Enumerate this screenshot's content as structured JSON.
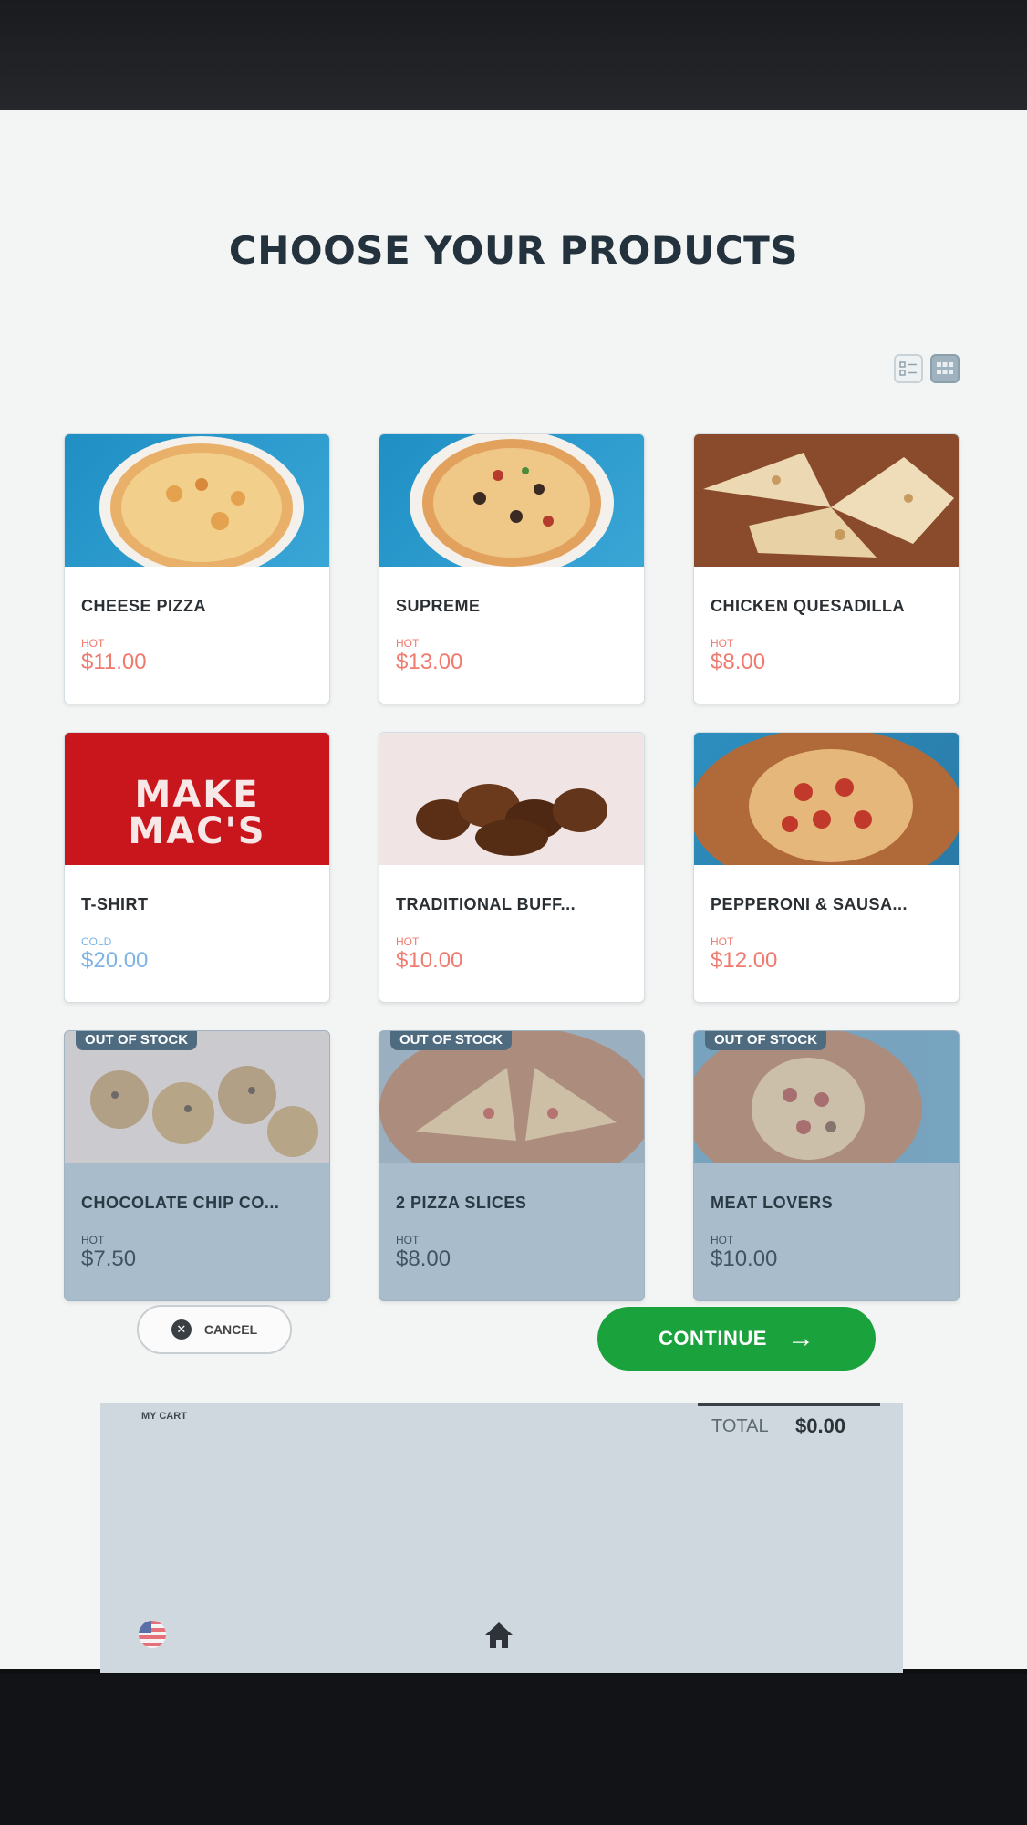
{
  "page": {
    "title": "CHOOSE YOUR PRODUCTS"
  },
  "view_toggle": {
    "options": [
      "list-view-icon",
      "grid-view-icon"
    ],
    "selected": "grid-view-icon"
  },
  "products": [
    {
      "name": "CHEESE PIZZA",
      "tag": "HOT",
      "price": "$11.00",
      "out_of_stock": false
    },
    {
      "name": "SUPREME",
      "tag": "HOT",
      "price": "$13.00",
      "out_of_stock": false
    },
    {
      "name": "CHICKEN QUESADILLA",
      "tag": "HOT",
      "price": "$8.00",
      "out_of_stock": false
    },
    {
      "name": "T-SHIRT",
      "tag": "COLD",
      "price": "$20.00",
      "out_of_stock": false
    },
    {
      "name": "TRADITIONAL BUFF...",
      "tag": "HOT",
      "price": "$10.00",
      "out_of_stock": false
    },
    {
      "name": "PEPPERONI & SAUSA...",
      "tag": "HOT",
      "price": "$12.00",
      "out_of_stock": false
    },
    {
      "name": "CHOCOLATE CHIP CO...",
      "tag": "HOT",
      "price": "$7.50",
      "out_of_stock": true
    },
    {
      "name": "2 PIZZA SLICES",
      "tag": "HOT",
      "price": "$8.00",
      "out_of_stock": true
    },
    {
      "name": "MEAT LOVERS",
      "tag": "HOT",
      "price": "$10.00",
      "out_of_stock": true
    }
  ],
  "badges": {
    "out_of_stock": "OUT OF STOCK"
  },
  "tshirt_print": "MAKE MAC'S",
  "actions": {
    "cancel_label": "CANCEL",
    "continue_label": "CONTINUE"
  },
  "cart": {
    "label": "MY CART",
    "total_label": "TOTAL",
    "total_value": "$0.00"
  },
  "colors": {
    "continue": "#1aa23c",
    "hot_price": "#f07a6d",
    "cold_price": "#7eb3e6",
    "out_of_stock_card": "#a9bccb",
    "badge": "#4f6b80"
  }
}
